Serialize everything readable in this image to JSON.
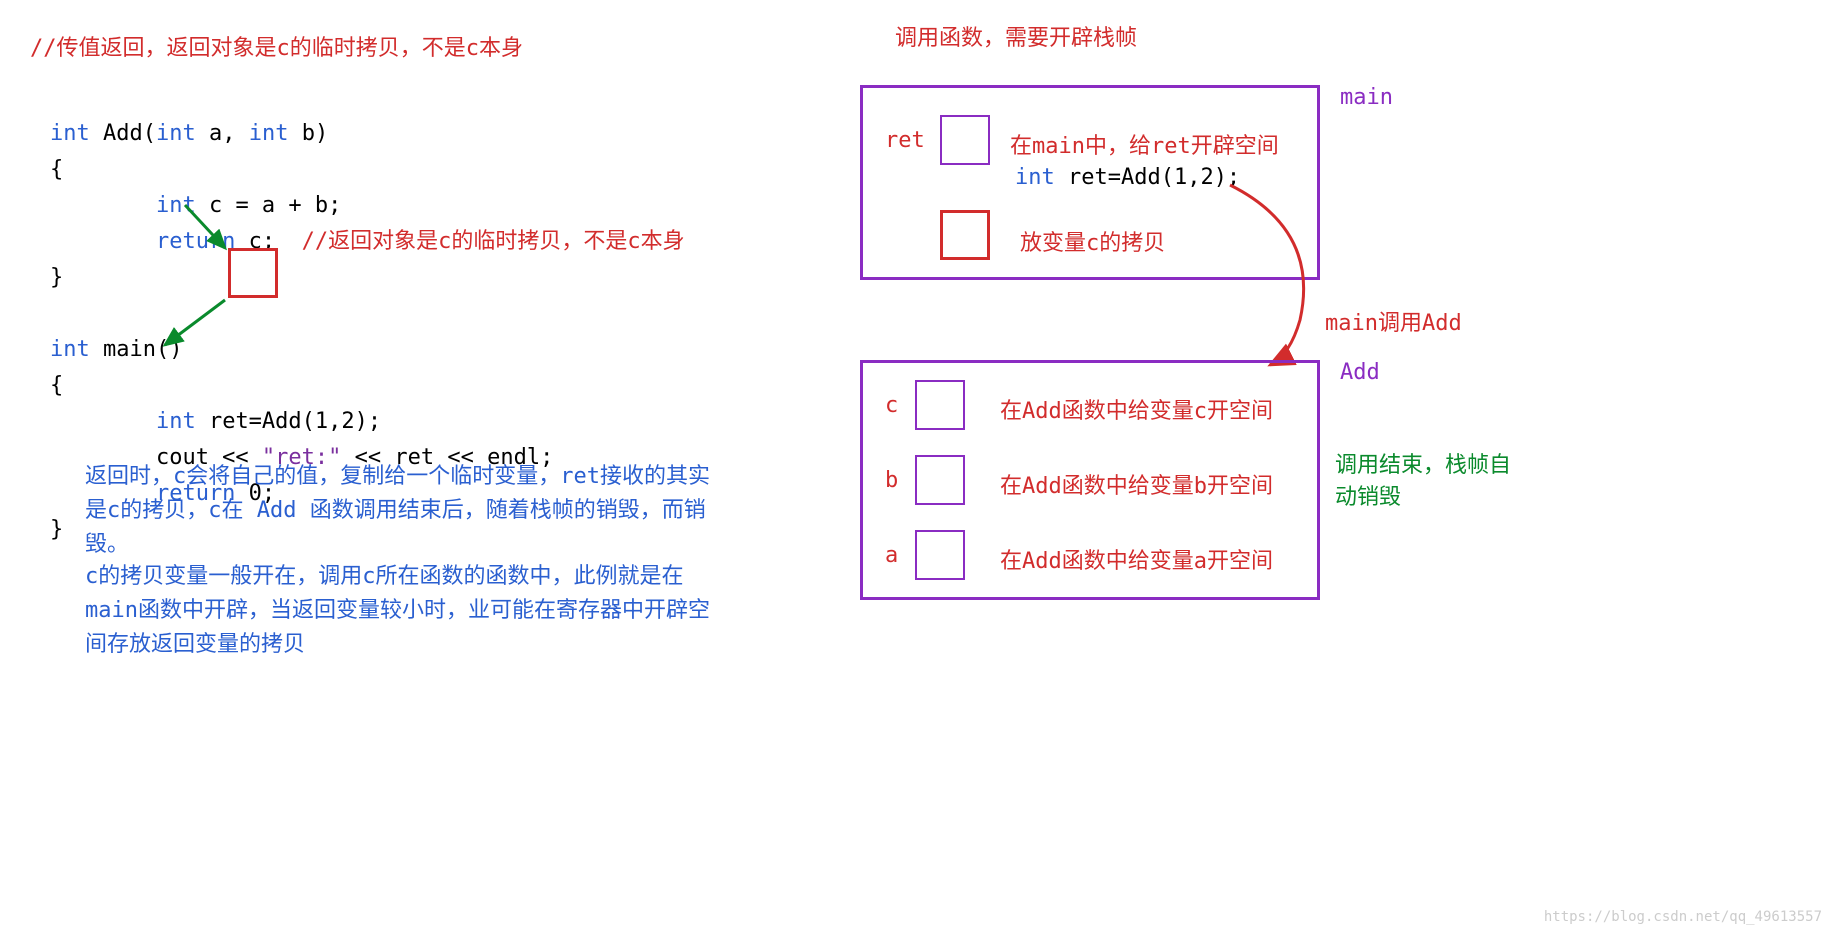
{
  "title_left": "//传值返回，返回对象是c的临时拷贝，不是c本身",
  "code": {
    "line1a": "int",
    "line1b": " Add(",
    "line1c": "int",
    "line1d": " a, ",
    "line1e": "int",
    "line1f": " b)",
    "line2": "{",
    "line3a": "        int",
    "line3b": " c = a + b;",
    "line4a": "        return",
    "line4b": " c;",
    "line4c": "  //返回对象是c的临时拷贝，不是c本身",
    "line5": "}",
    "line6": "",
    "line7a": "int",
    "line7b": " main()",
    "line8": "{",
    "line9a": "        int",
    "line9b": " ret=Add(1,2);",
    "line10a": "        cout << ",
    "line10b": "\"ret:\"",
    "line10c": " << ret << endl;",
    "line11a": "        return",
    "line11b": " 0;",
    "line12": "}"
  },
  "note1": "返回时，c会将自己的值，复制给一个临时变量，ret接收的其实是c的拷贝，c在 Add 函数调用结束后，随着栈帧的销毁，而销毁。",
  "note2": "c的拷贝变量一般开在，调用c所在函数的函数中，此例就是在main函数中开辟，当返回变量较小时，业可能在寄存器中开辟空间存放返回变量的拷贝",
  "right_title": "调用函数，需要开辟栈帧",
  "main_label": "main",
  "add_label": "Add",
  "ret_label": "ret",
  "ret_note": "在main中，给ret开辟空间",
  "ret_code_int": "int",
  "ret_code_rest": " ret=Add(1,2);",
  "c_copy_note": "放变量c的拷贝",
  "arrow_label": "main调用Add",
  "c_label": "c",
  "c_note": "在Add函数中给变量c开空间",
  "b_label": "b",
  "b_note": "在Add函数中给变量b开空间",
  "a_label": "a",
  "a_note": "在Add函数中给变量a开空间",
  "green_note": "调用结束，栈帧自动销毁",
  "watermark": "https://blog.csdn.net/qq_49613557"
}
